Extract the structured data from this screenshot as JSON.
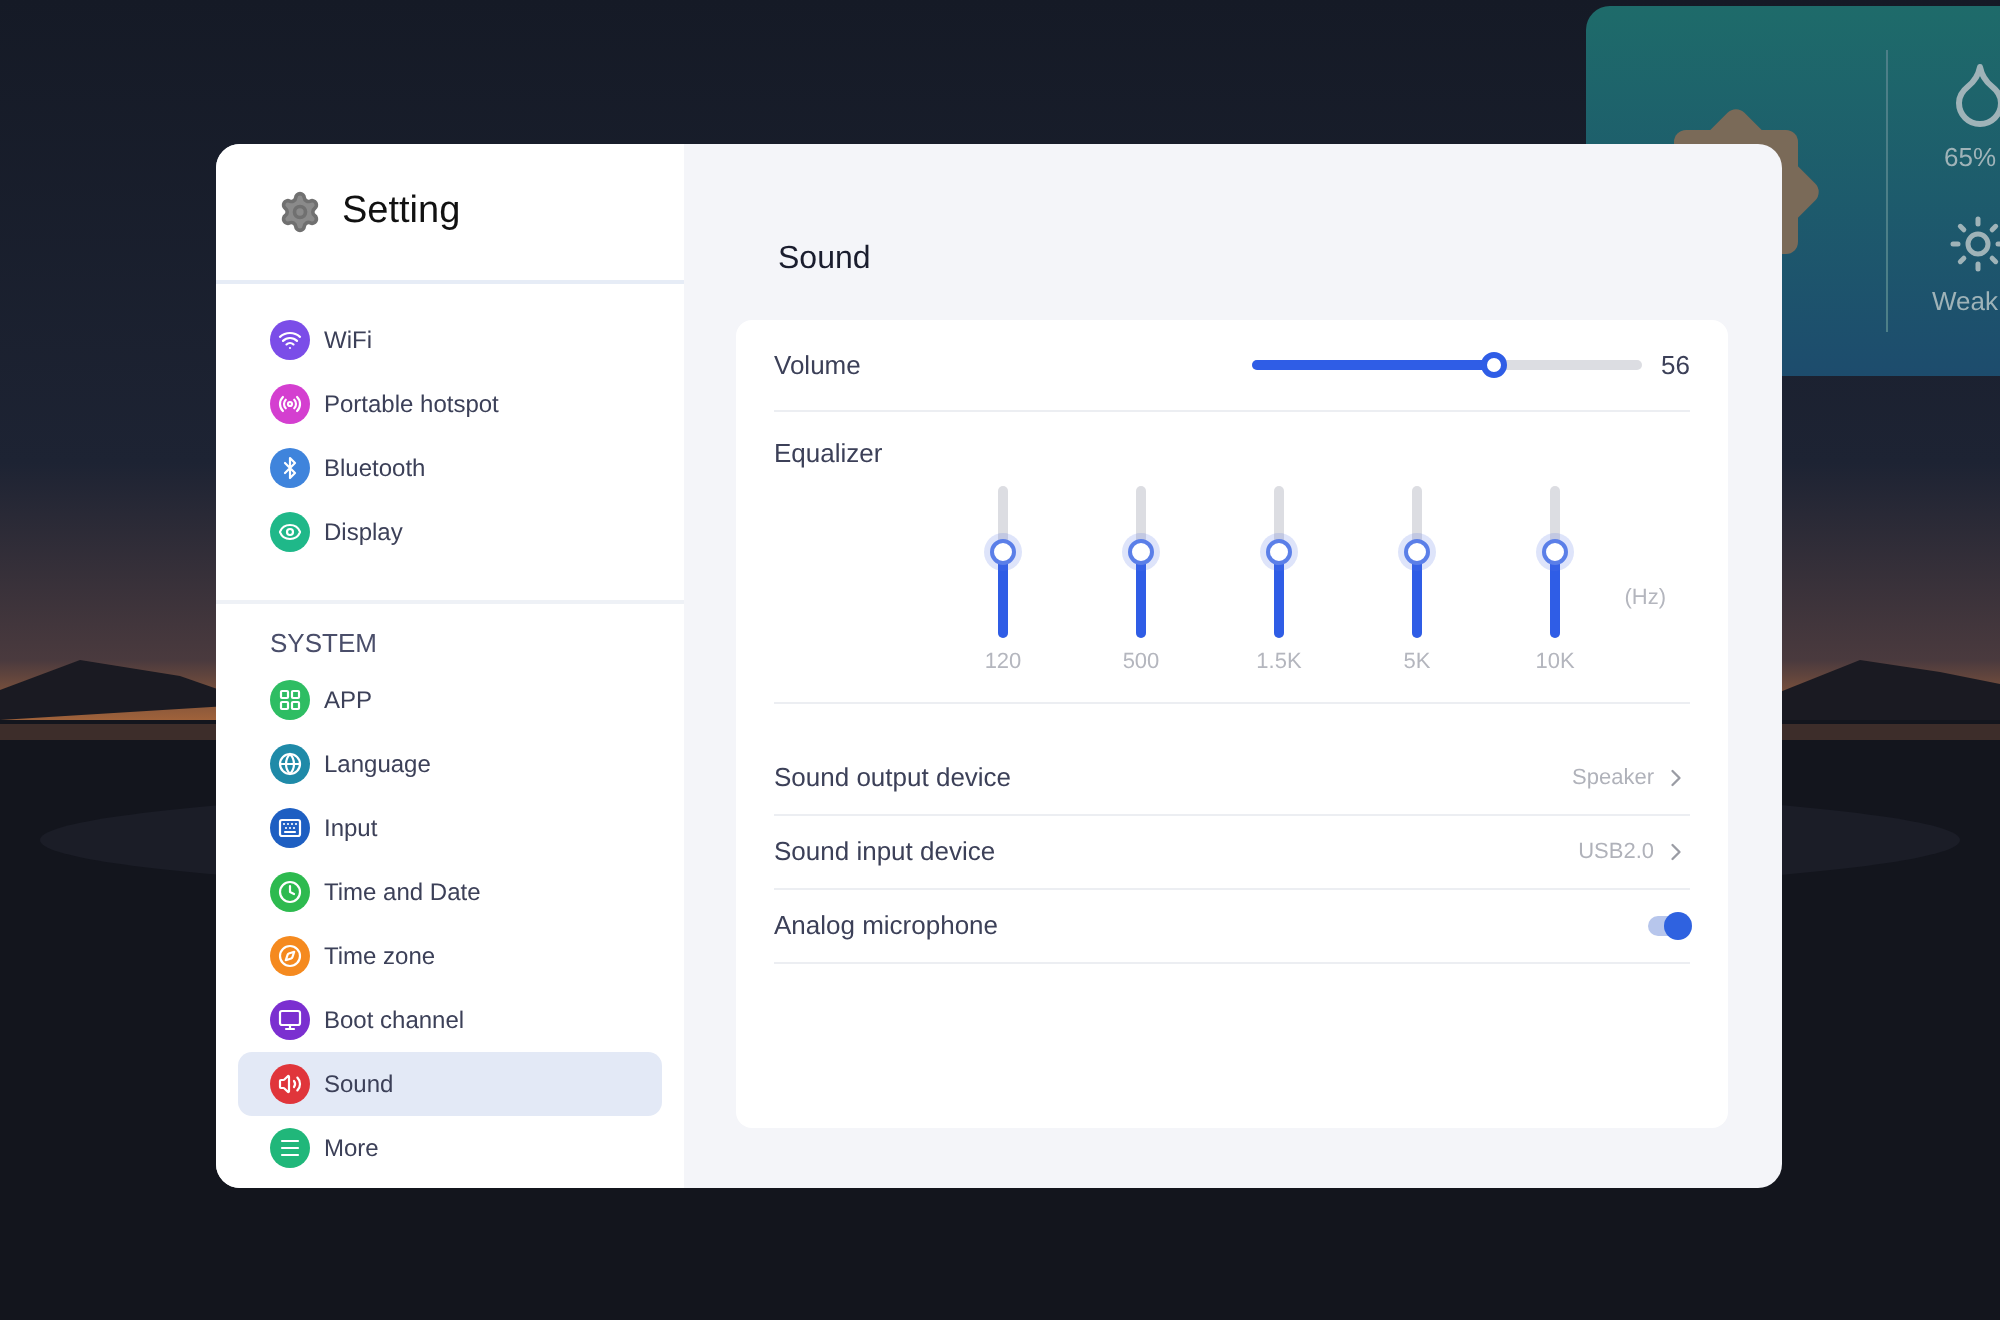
{
  "weather": {
    "humidity": "65%",
    "uv": "Weak"
  },
  "sidebar": {
    "title": "Setting",
    "groups": [
      {
        "items": [
          {
            "label": "WiFi",
            "color": "#7b4de8",
            "selected": false
          },
          {
            "label": "Portable hotspot",
            "color": "#d43fd0",
            "selected": false
          },
          {
            "label": "Bluetooth",
            "color": "#3f84dc",
            "selected": false
          },
          {
            "label": "Display",
            "color": "#1fb889",
            "selected": false
          }
        ]
      },
      {
        "heading": "SYSTEM",
        "items": [
          {
            "label": "APP",
            "color": "#2ebd63",
            "selected": false
          },
          {
            "label": "Language",
            "color": "#1f8aa8",
            "selected": false
          },
          {
            "label": "Input",
            "color": "#1e5fc2",
            "selected": false
          },
          {
            "label": "Time and Date",
            "color": "#2dba4f",
            "selected": false
          },
          {
            "label": "Time zone",
            "color": "#f58a1f",
            "selected": false
          },
          {
            "label": "Boot channel",
            "color": "#7b2fd0",
            "selected": false
          },
          {
            "label": "Sound",
            "color": "#e0353b",
            "selected": true
          },
          {
            "label": "More",
            "color": "#20b77a",
            "selected": false
          }
        ]
      }
    ]
  },
  "content": {
    "title": "Sound",
    "volume": {
      "label": "Volume",
      "level": 0.62,
      "reading": "56"
    },
    "equalizer": {
      "label": "Equalizer",
      "unit": "(Hz)",
      "bands": [
        {
          "label": "120",
          "level": 0.56
        },
        {
          "label": "500",
          "level": 0.56
        },
        {
          "label": "1.5K",
          "level": 0.56
        },
        {
          "label": "5K",
          "level": 0.56
        },
        {
          "label": "10K",
          "level": 0.56
        }
      ]
    },
    "rows": [
      {
        "kind": "link",
        "label": "Sound output device",
        "value": "Speaker"
      },
      {
        "kind": "link",
        "label": "Sound input device",
        "value": "USB2.0"
      },
      {
        "kind": "toggle",
        "label": "Analog microphone",
        "on": true
      }
    ]
  }
}
